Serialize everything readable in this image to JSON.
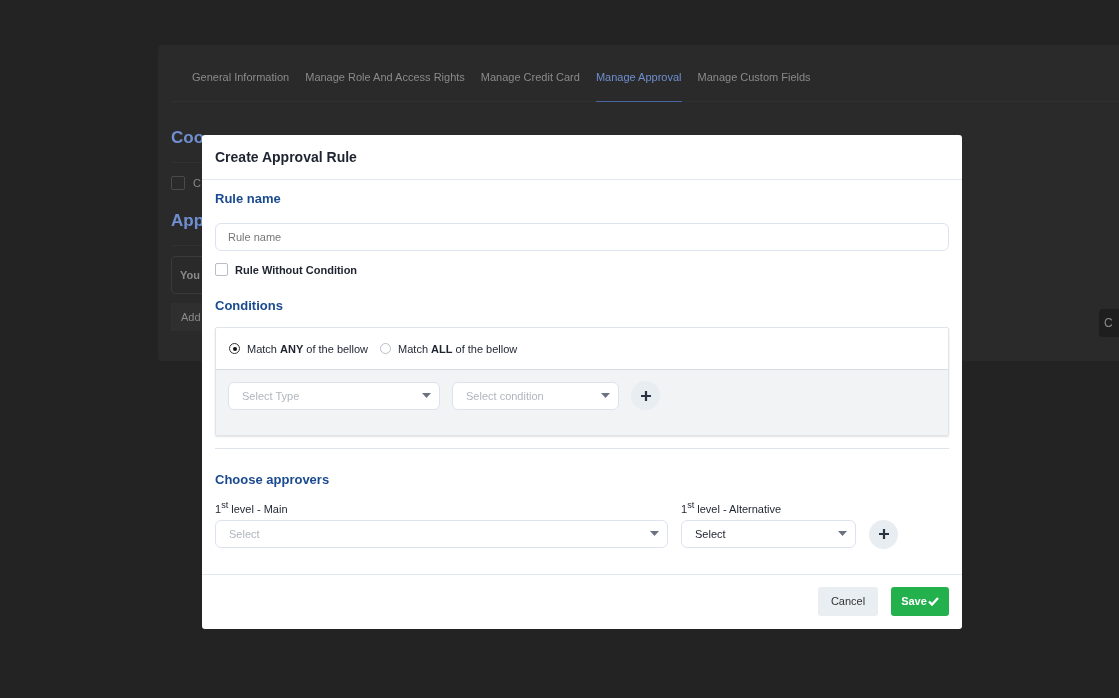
{
  "background": {
    "tabs": [
      {
        "label": "General Information",
        "selected": false
      },
      {
        "label": "Manage Role And Access Rights",
        "selected": false
      },
      {
        "label": "Manage Credit Card",
        "selected": false
      },
      {
        "label": "Manage Approval",
        "selected": true
      },
      {
        "label": "Manage Custom Fields",
        "selected": false
      }
    ],
    "first_heading": "Coo",
    "checkbox_checked": false,
    "checkbox_label": "C",
    "second_heading": "App",
    "panel_text": "You",
    "link_text": "Add",
    "right_button": "C"
  },
  "modal": {
    "title": "Create Approval Rule",
    "rule_name": {
      "heading": "Rule name",
      "placeholder": "Rule name"
    },
    "without_condition": {
      "label": "Rule Without Condition",
      "checked": false
    },
    "conditions": {
      "heading": "Conditions",
      "match_options": [
        {
          "label": "Match **ANY** of the bellow",
          "selected": true
        },
        {
          "label": "Match **ALL** of the bellow",
          "selected": false
        }
      ],
      "rows": [
        {
          "type_placeholder": "Select Type",
          "condition_placeholder": "Select condition"
        }
      ]
    },
    "approvers": {
      "heading": "Choose approvers",
      "levels": [
        {
          "label": "1$^{st}$ level - Main",
          "placeholder": "Select",
          "kind": "wide"
        },
        {
          "label": "1$^{st}$ level - Alternative",
          "value": "Select",
          "kind": "narrow"
        }
      ]
    },
    "buttons": [
      {
        "label": "Cancel",
        "kind": "secondary"
      },
      {
        "label": "Save",
        "kind": "primary"
      }
    ]
  }
}
